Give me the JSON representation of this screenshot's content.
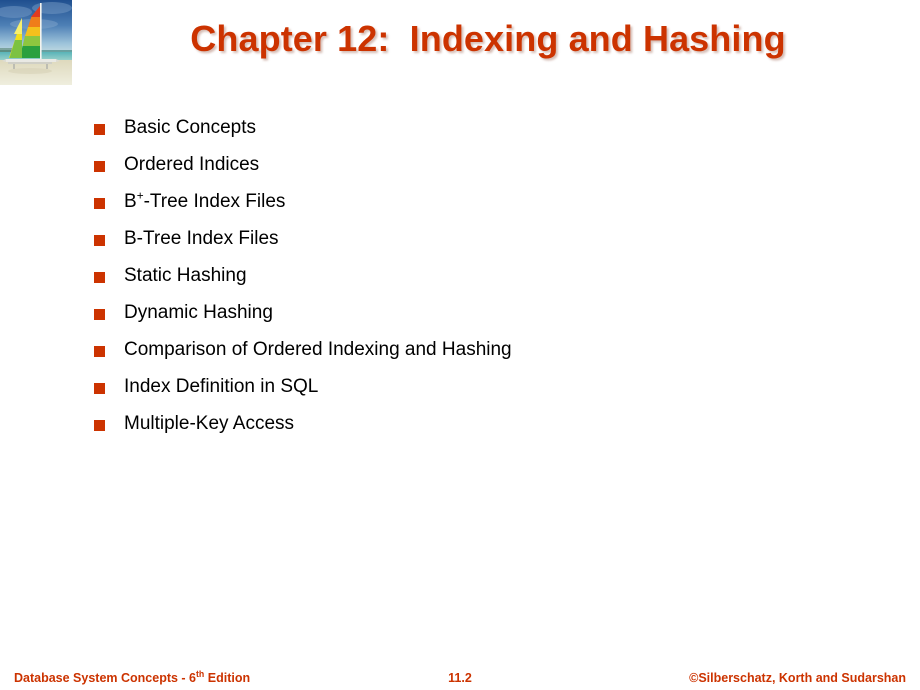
{
  "slide": {
    "title": "Chapter 12:  Indexing and Hashing",
    "background_color": "#FFFFFF",
    "accent_color": "#CC3300",
    "body_text_color": "#000000"
  },
  "logo": {
    "icon_name": "sailboat-photo",
    "alt": "Sailboat with rainbow-striped sails on a beach"
  },
  "outline": {
    "items": [
      {
        "label": "Basic Concepts"
      },
      {
        "label": "Ordered Indices"
      },
      {
        "label_prefix": "B",
        "label_sup": "+",
        "label_suffix": "-Tree Index Files",
        "label": "B+-Tree Index Files"
      },
      {
        "label": "B-Tree Index Files"
      },
      {
        "label": "Static Hashing"
      },
      {
        "label": "Dynamic Hashing"
      },
      {
        "label": "Comparison of Ordered Indexing and Hashing"
      },
      {
        "label": "Index Definition in SQL"
      },
      {
        "label": "Multiple-Key Access"
      }
    ]
  },
  "footer": {
    "left_prefix": "Database System Concepts - 6",
    "left_sup": "th",
    "left_suffix": " Edition",
    "left": "Database System Concepts - 6th Edition",
    "center": "11.2",
    "right": "©Silberschatz, Korth and Sudarshan"
  }
}
